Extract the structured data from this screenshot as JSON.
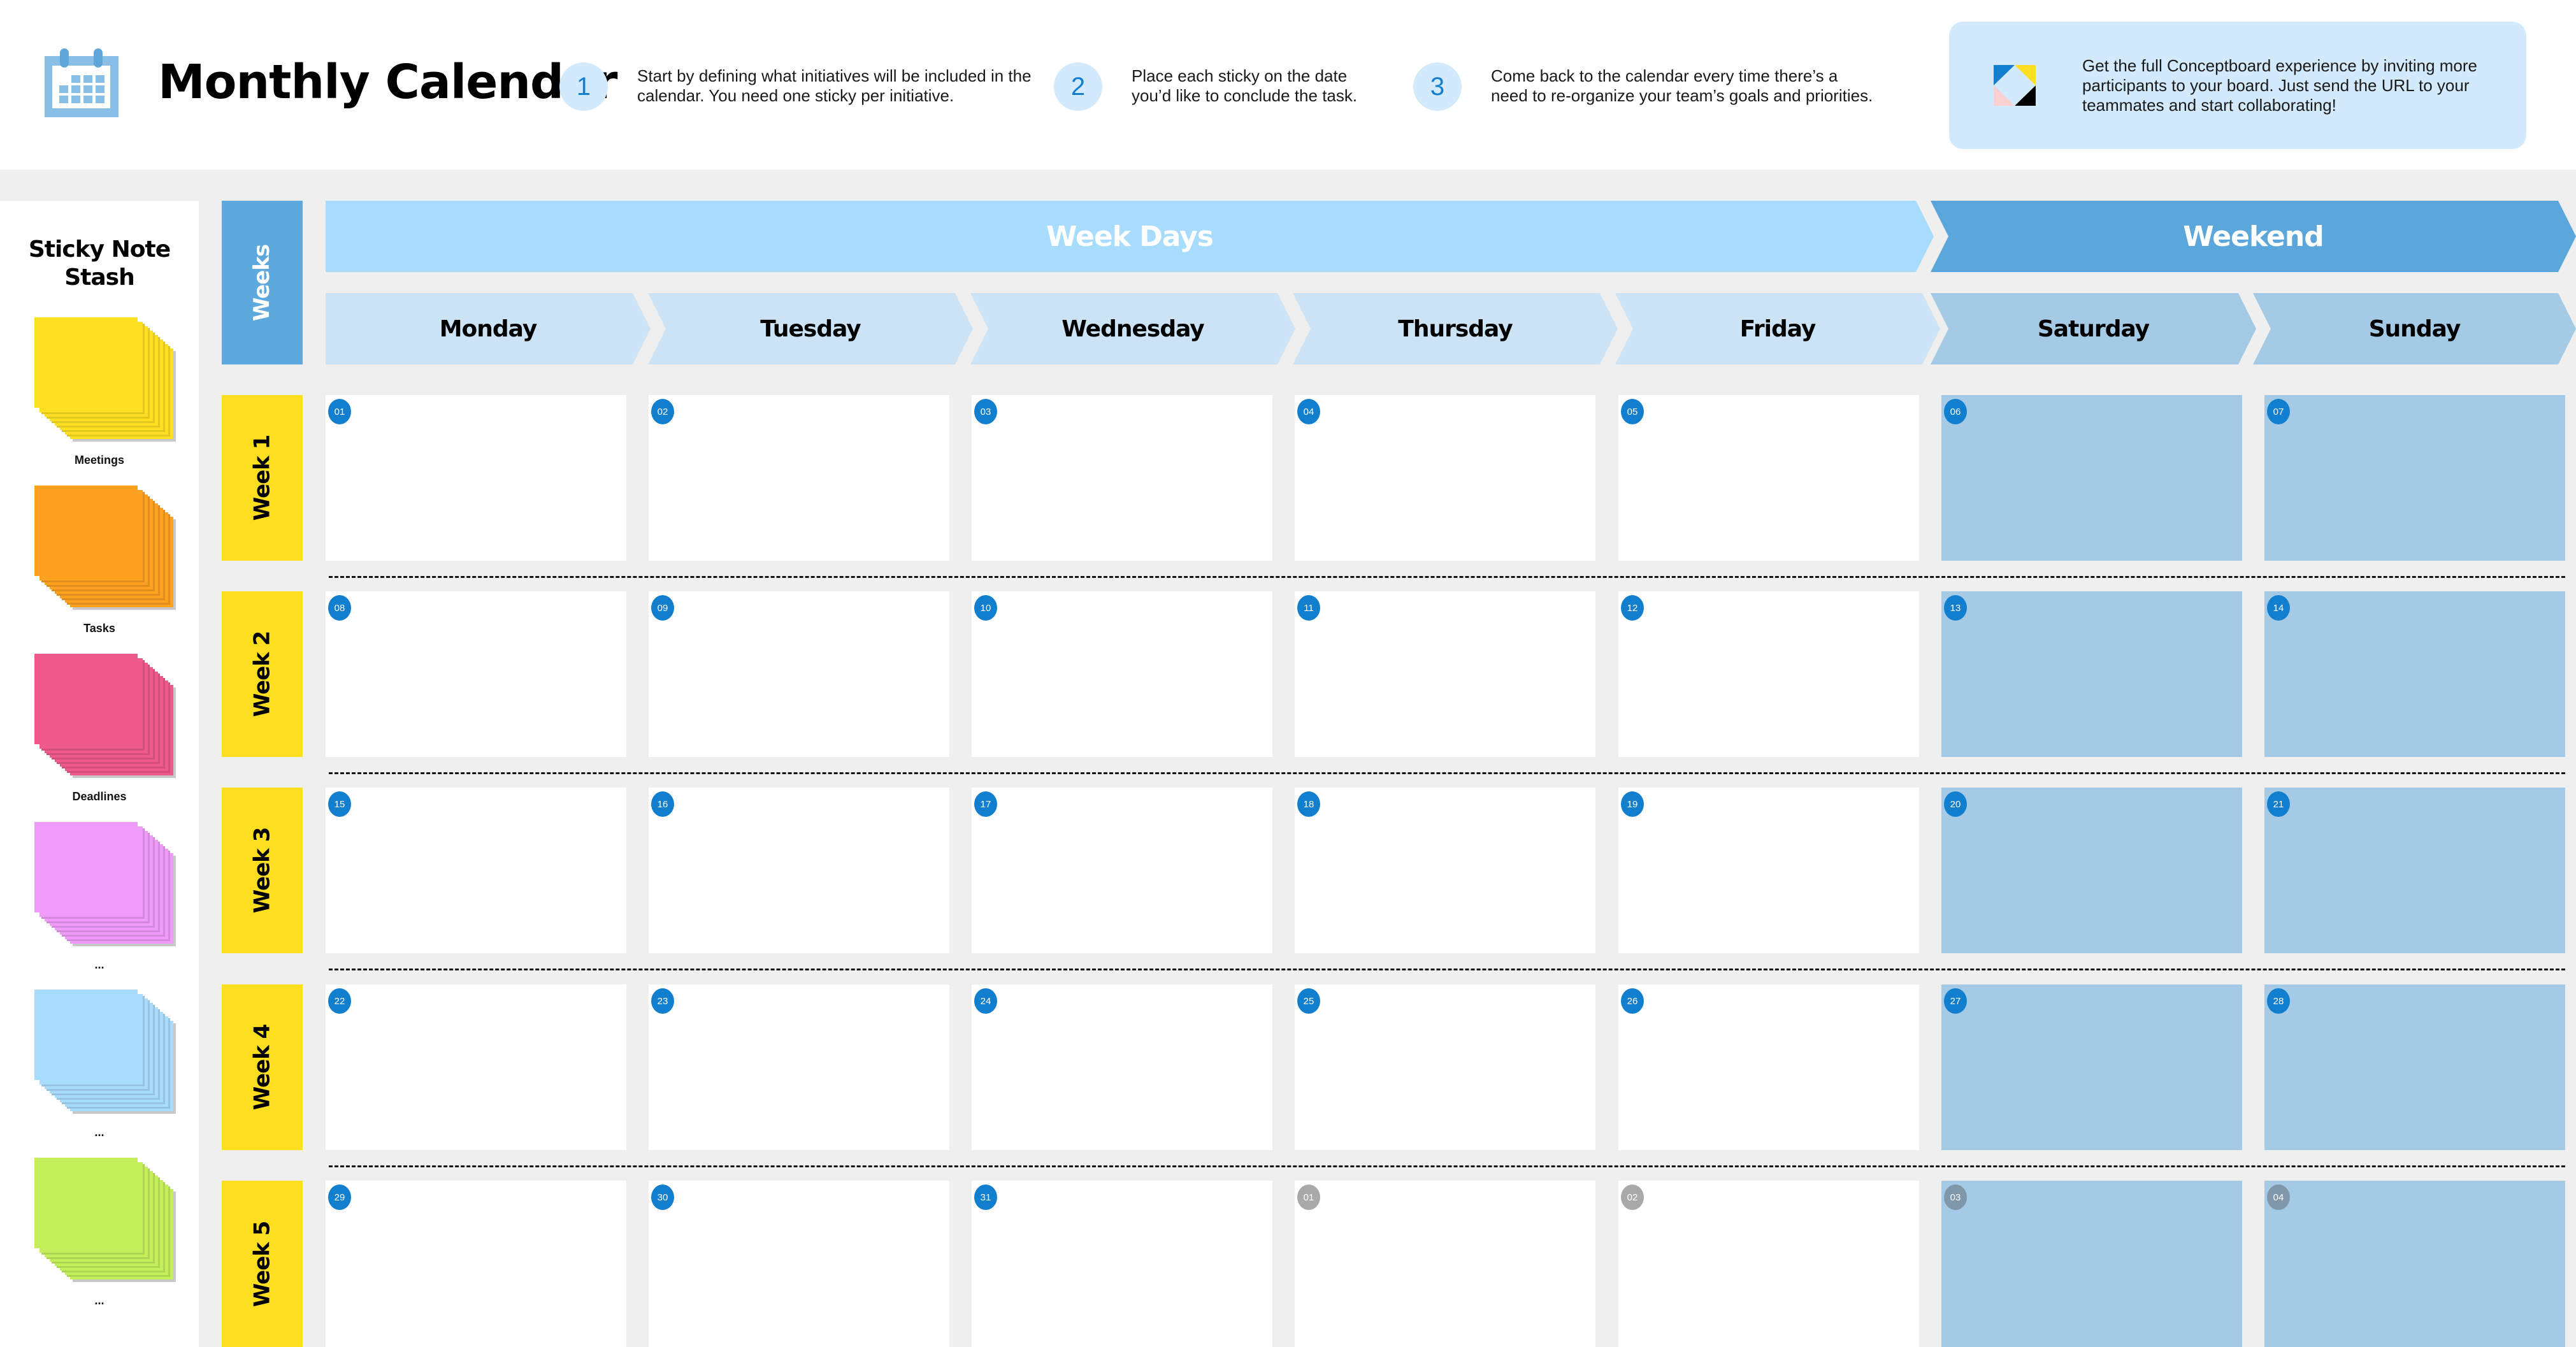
{
  "header": {
    "title": "Monthly Calendar",
    "title_icon": "calendar-icon",
    "steps": [
      {
        "number": "1",
        "text": "Start by defining what initiatives will be included in the calendar. You need one sticky per initiative."
      },
      {
        "number": "2",
        "text": "Place each sticky on the date you’d like to conclude the task."
      },
      {
        "number": "3",
        "text": "Come back to the calendar every time there’s a need to re-organize your team’s goals and priorities."
      }
    ],
    "promo": {
      "icon": "conceptboard-logo-icon",
      "text": "Get the full Conceptboard experience by inviting more participants to your board. Just send the URL to your teammates and start collaborating!"
    }
  },
  "stash": {
    "title": "Sticky Note Stash",
    "stacks": [
      {
        "label": "Meetings",
        "color": "#fede20",
        "edge": "#e2c71c"
      },
      {
        "label": "Tasks",
        "color": "#fea020",
        "edge": "#e28e1d"
      },
      {
        "label": "Deadlines",
        "color": "#ee5a8c",
        "edge": "#d44f7c"
      },
      {
        "label": "...",
        "color": "#f09afa",
        "edge": "#d488de"
      },
      {
        "label": "...",
        "color": "#a7dcfd",
        "edge": "#95c3e1"
      },
      {
        "label": "...",
        "color": "#c3ef5a",
        "edge": "#aed450"
      }
    ]
  },
  "calendar": {
    "weeks_header": "Weeks",
    "weekdays_banner": "Week Days",
    "weekend_banner": "Weekend",
    "days": [
      "Monday",
      "Tuesday",
      "Wednesday",
      "Thursday",
      "Friday",
      "Saturday",
      "Sunday"
    ],
    "weeks": [
      {
        "label": "Week 1",
        "dates": [
          {
            "d": "01"
          },
          {
            "d": "02"
          },
          {
            "d": "03"
          },
          {
            "d": "04"
          },
          {
            "d": "05"
          },
          {
            "d": "06"
          },
          {
            "d": "07"
          }
        ]
      },
      {
        "label": "Week 2",
        "dates": [
          {
            "d": "08"
          },
          {
            "d": "09"
          },
          {
            "d": "10"
          },
          {
            "d": "11"
          },
          {
            "d": "12"
          },
          {
            "d": "13"
          },
          {
            "d": "14"
          }
        ]
      },
      {
        "label": "Week 3",
        "dates": [
          {
            "d": "15"
          },
          {
            "d": "16"
          },
          {
            "d": "17"
          },
          {
            "d": "18"
          },
          {
            "d": "19"
          },
          {
            "d": "20"
          },
          {
            "d": "21"
          }
        ]
      },
      {
        "label": "Week 4",
        "dates": [
          {
            "d": "22"
          },
          {
            "d": "23"
          },
          {
            "d": "24"
          },
          {
            "d": "25"
          },
          {
            "d": "26"
          },
          {
            "d": "27"
          },
          {
            "d": "28"
          }
        ]
      },
      {
        "label": "Week 5",
        "dates": [
          {
            "d": "29"
          },
          {
            "d": "30"
          },
          {
            "d": "31"
          },
          {
            "d": "01",
            "muted": true
          },
          {
            "d": "02",
            "muted": true
          },
          {
            "d": "03",
            "muted": true
          },
          {
            "d": "04",
            "muted": true
          }
        ]
      }
    ],
    "colors": {
      "weekday_banner": "#a8dcfd",
      "weekend_banner": "#5ba7db",
      "weekday_header": "#cbe3f5",
      "weekend_header": "#a4cae5",
      "week_label": "#fedf20",
      "date_badge": "#127fce",
      "date_badge_muted": "#a9a9a9"
    }
  }
}
